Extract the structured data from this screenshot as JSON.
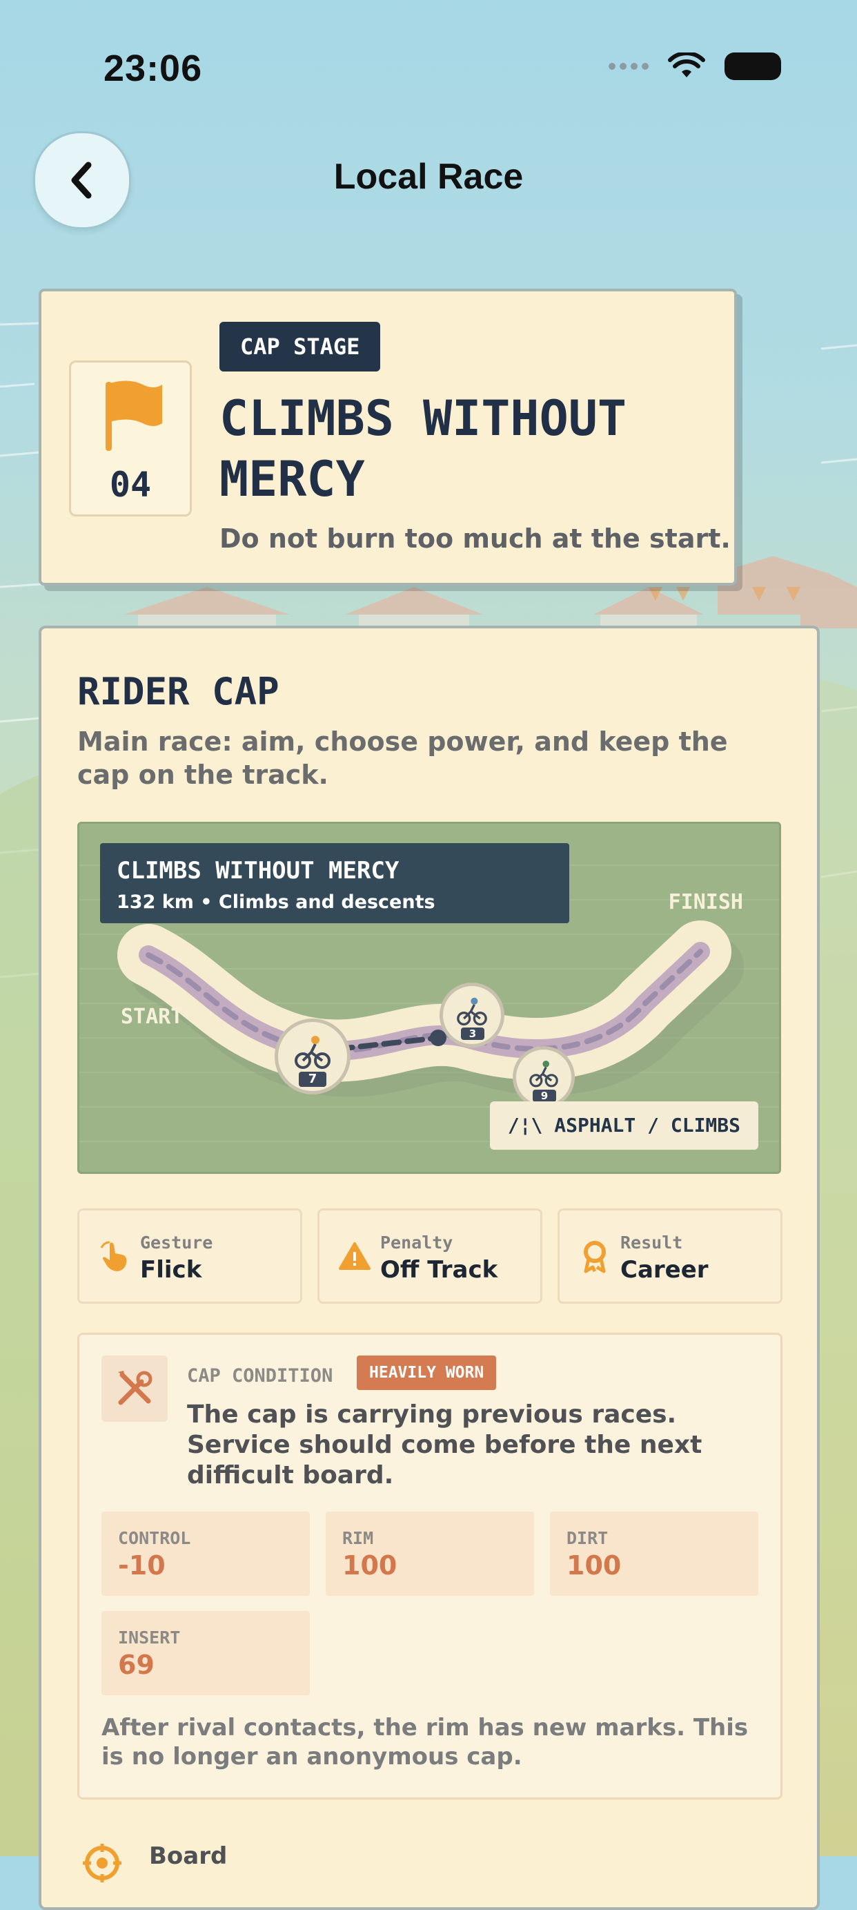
{
  "status_bar": {
    "time": "23:06"
  },
  "header": {
    "title": "Local Race"
  },
  "stage": {
    "number": "04",
    "chip": "CAP STAGE",
    "title": "CLIMBS WITHOUT MERCY",
    "subtitle": "Do not burn too much at the start."
  },
  "rider_cap": {
    "title": "RIDER CAP",
    "description": "Main race: aim, choose power, and keep the cap on the track."
  },
  "track": {
    "name": "CLIMBS WITHOUT MERCY",
    "details": "132 km • Climbs and descents",
    "start_label": "START",
    "finish_label": "FINISH",
    "surface": "/¦\\ ASPHALT / CLIMBS",
    "riders": [
      {
        "number": "7",
        "color": "#e9a23b"
      },
      {
        "number": "3",
        "color": "#5c8fb6"
      },
      {
        "number": "9",
        "color": "#4c8a58"
      }
    ]
  },
  "info_tiles": [
    {
      "label": "Gesture",
      "value": "Flick",
      "icon": "hand-pointer-icon"
    },
    {
      "label": "Penalty",
      "value": "Off Track",
      "icon": "warning-icon"
    },
    {
      "label": "Result",
      "value": "Career",
      "icon": "award-icon"
    }
  ],
  "condition": {
    "label": "CAP CONDITION",
    "badge": "HEAVILY WORN",
    "text": "The cap is carrying previous races. Service should come before the next difficult board.",
    "stats": [
      {
        "label": "CONTROL",
        "value": "-10"
      },
      {
        "label": "RIM",
        "value": "100"
      },
      {
        "label": "DIRT",
        "value": "100"
      },
      {
        "label": "INSERT",
        "value": "69"
      }
    ],
    "note": "After rival contacts, the rim has new marks. This is no longer an anonymous cap."
  },
  "board": {
    "label": "Board"
  },
  "colors": {
    "accent": "#f0a030",
    "navy": "#243449",
    "warn": "#d47b51"
  }
}
